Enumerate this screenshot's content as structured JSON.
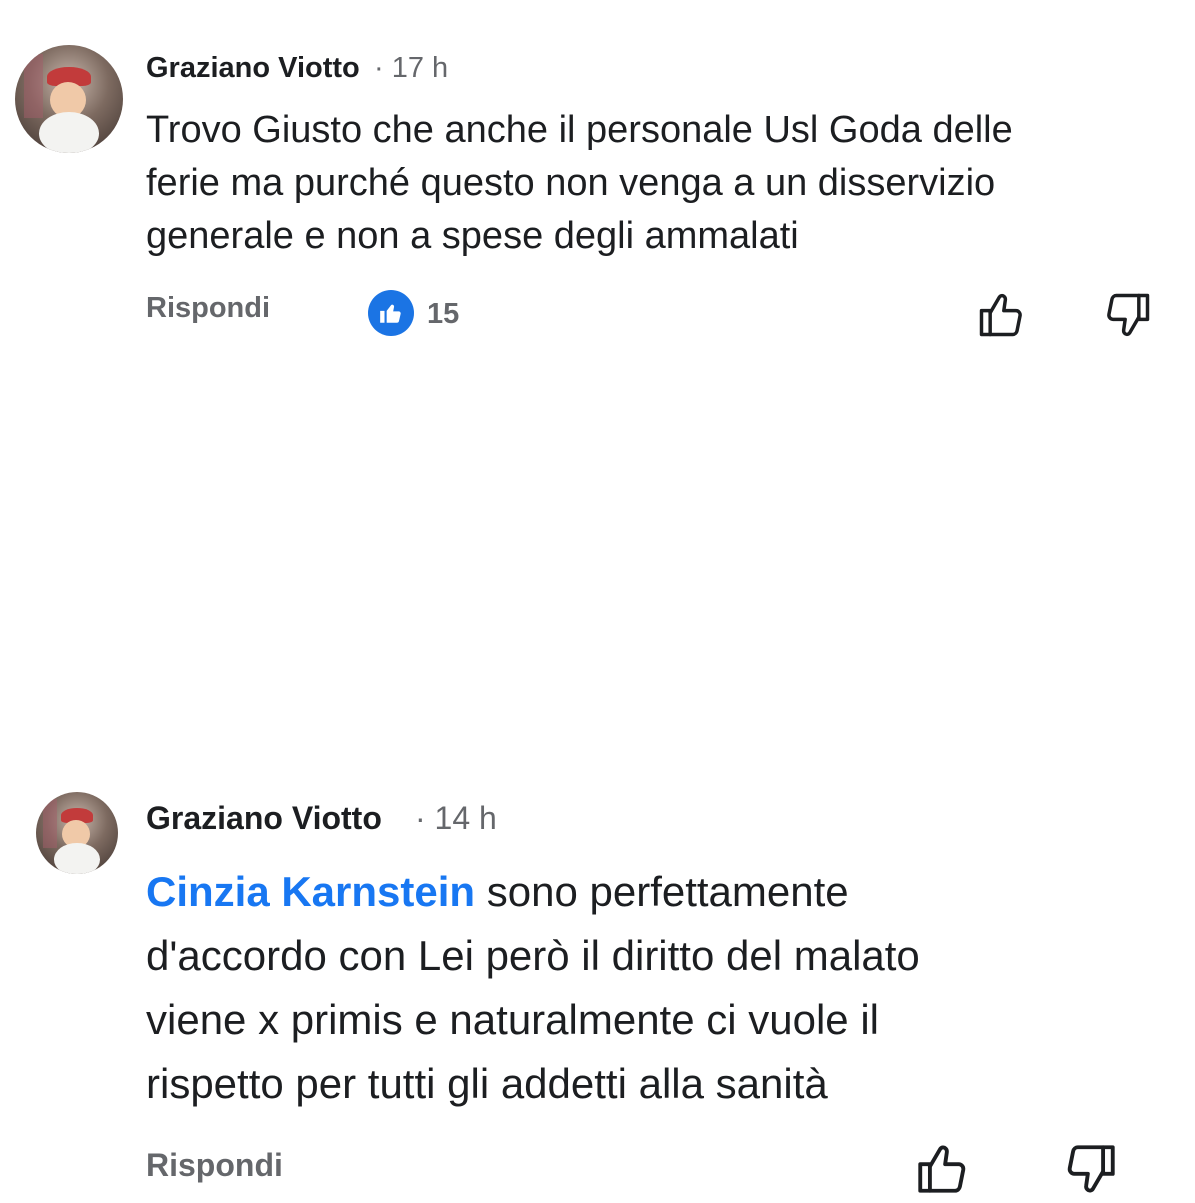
{
  "comments": [
    {
      "author": "Graziano Viotto",
      "time": "· 17 h",
      "mention": "",
      "text": "Trovo Giusto che anche il personale Usl Goda delle\nferie ma purché questo non venga a un disservizio\ngenerale e non a spese degli ammalati",
      "reply_label": "Rispondi",
      "like_count": "15",
      "avatar_icon": "user-avatar",
      "like_icon": "thumbs-up-icon",
      "dislike_icon": "thumbs-down-icon"
    },
    {
      "author": "Graziano Viotto",
      "time": "· 14 h",
      "mention": "Cinzia Karnstein",
      "text": " sono perfettamente\nd'accordo con Lei però il diritto del malato\nviene x primis e naturalmente ci vuole il\nrispetto per tutti gli addetti alla sanità",
      "reply_label": "Rispondi",
      "avatar_icon": "user-avatar",
      "like_icon": "thumbs-up-icon",
      "dislike_icon": "thumbs-down-icon"
    }
  ],
  "colors": {
    "text": "#1c1e21",
    "muted": "#65676b",
    "accent": "#1877f2"
  }
}
